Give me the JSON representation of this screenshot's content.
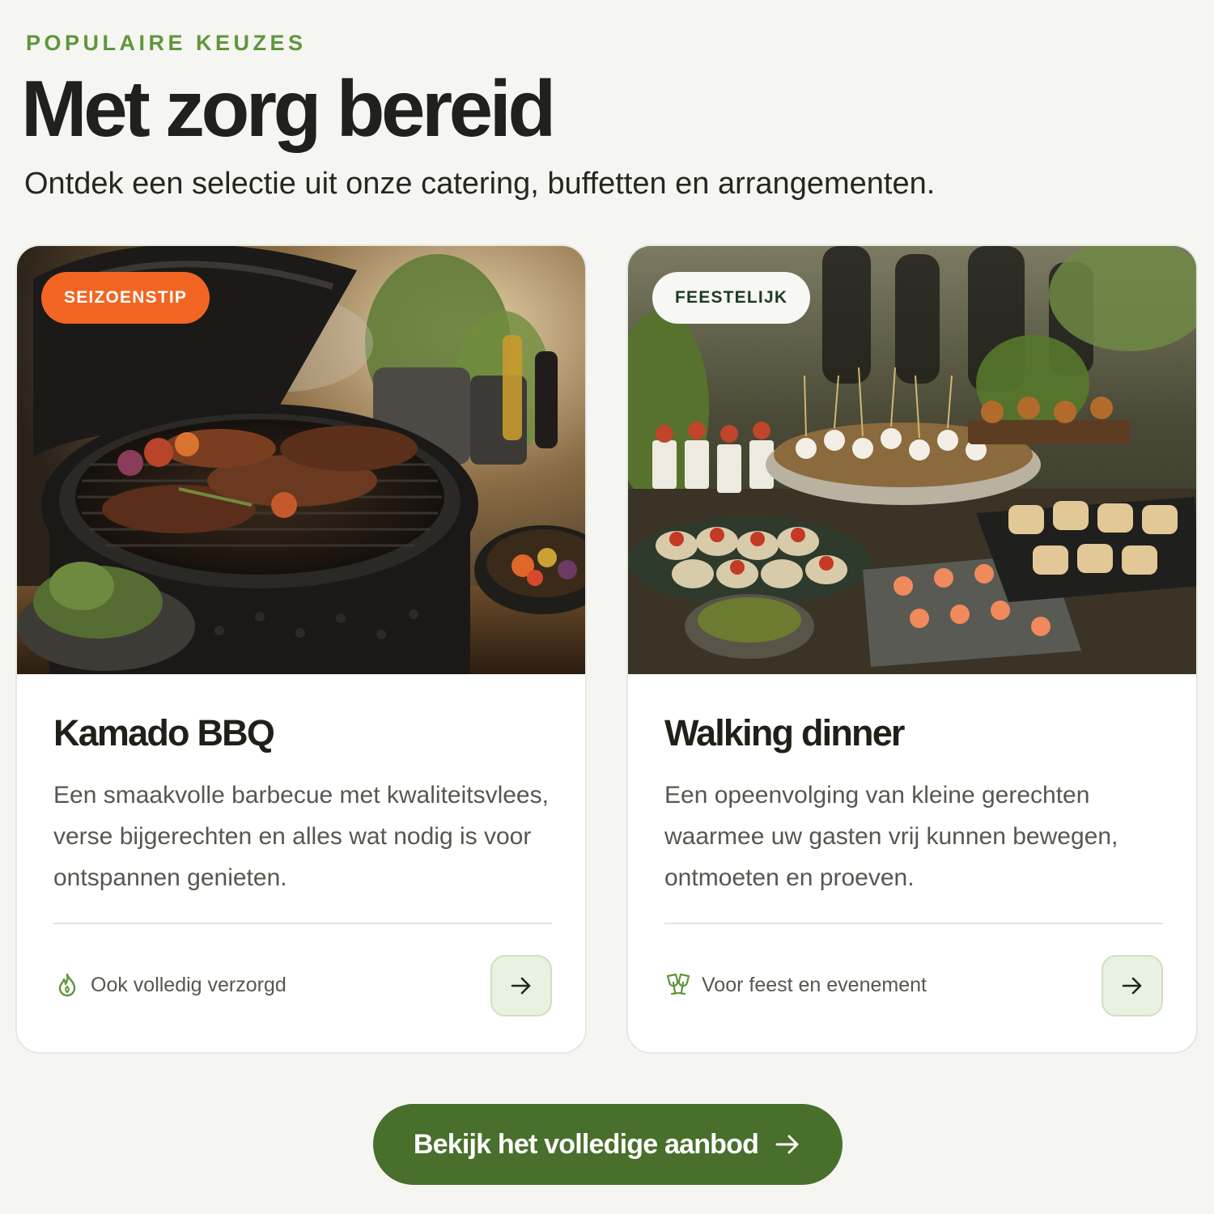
{
  "section": {
    "eyebrow": "POPULAIRE KEUZES",
    "title": "Met zorg bereid",
    "subtitle": "Ontdek een selectie uit onze catering, buffetten en arrangementen."
  },
  "cards": [
    {
      "badge": "SEIZOENSTIP",
      "title": "Kamado BBQ",
      "description": "Een smaakvolle barbecue met kwaliteitsvlees, verse bijgerechten en alles wat nodig is voor ontspannen genieten.",
      "feature": "Ook volledig verzorgd",
      "feature_icon": "flame-icon",
      "image": "kamado-grill-photo"
    },
    {
      "badge": "FEESTELIJK",
      "title": "Walking dinner",
      "description": "Een opeenvolging van kleine gerechten waarmee uw gasten vrij kunnen bewegen, ontmoeten en proeven.",
      "feature": "Voor feest en evenement",
      "feature_icon": "toast-glasses-icon",
      "image": "walking-dinner-buffet-photo"
    }
  ],
  "cta": {
    "label": "Bekijk het volledige aanbod"
  },
  "colors": {
    "accent_green": "#486f2b",
    "eyebrow_green": "#5f963a",
    "badge_orange": "#f26522",
    "background": "#f5f6f2"
  }
}
